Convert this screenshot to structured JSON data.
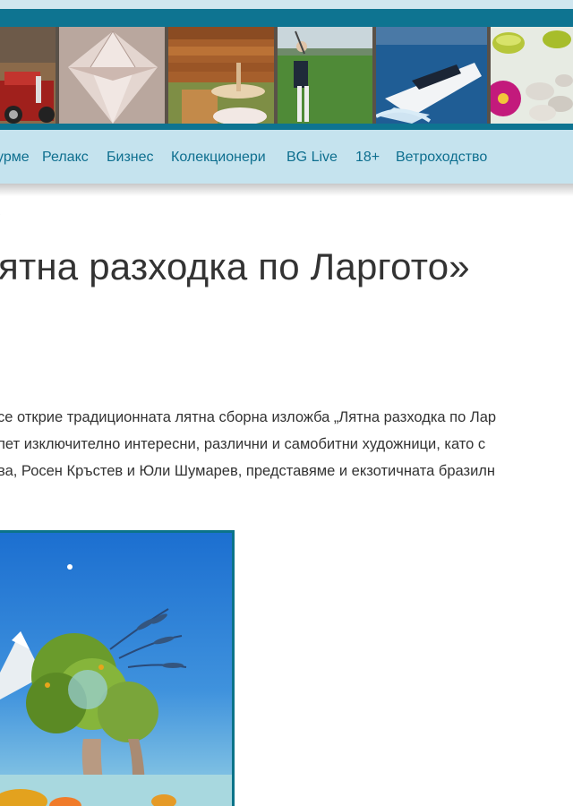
{
  "banner": {
    "tiles": [
      "vintage-car",
      "diamond",
      "spa-wood",
      "golfer",
      "speedboat",
      "spa-stones"
    ]
  },
  "nav": {
    "items": [
      {
        "label": "урме"
      },
      {
        "label": "Релакс"
      },
      {
        "label": "Бизнес"
      },
      {
        "label": "Колекционери"
      },
      {
        "label": "BG Live"
      },
      {
        "label": "18+"
      },
      {
        "label": "Ветроходство"
      }
    ]
  },
  "breadcrumb": {
    "text": "›"
  },
  "article": {
    "title": "ятна разходка по Ларгото»",
    "lines": [
      "се открие традиционната лятна сборна изложба „Лятна разходка по Лар",
      "пет изключително интересни, различни и самобитни художници, като с",
      "ва, Росен Кръстев и Юли Шумарев, представяме и екзотичната бразилн"
    ]
  },
  "colors": {
    "brand_teal": "#0e7491",
    "nav_bg": "#c5e3ee",
    "nav_text": "#0e6f8f",
    "text": "#333333"
  }
}
